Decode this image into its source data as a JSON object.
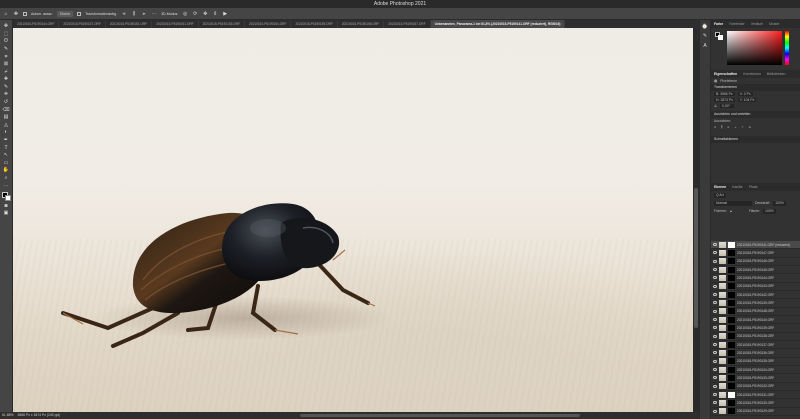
{
  "window": {
    "title": "Adobe Photoshop 2021"
  },
  "options_bar": {
    "auto_select_label": "Autom. ausw.:",
    "layer_select": "Ebene",
    "transform_label": "Transformationsstrg.",
    "three_d_label": "3D-Modus:"
  },
  "doc_tabs": [
    {
      "label": "20210015-P5190144.ORF",
      "active": false
    },
    {
      "label": "20210015-P5190157.ORF",
      "active": false
    },
    {
      "label": "20210015-P5190151.ORF",
      "active": false
    },
    {
      "label": "20210015-P5190151.ORF",
      "active": false
    },
    {
      "label": "20210015-P5190153.ORF",
      "active": false
    },
    {
      "label": "20210015-P5190154.ORF",
      "active": false
    },
    {
      "label": "20210015-P5190155.ORF",
      "active": false
    },
    {
      "label": "20210015-P5190156.ORF",
      "active": false
    },
    {
      "label": "20210015-P5190157.ORF",
      "active": false
    },
    {
      "label": "Unbenanntes_Panorama-1 bei 61,8% (20210015-P5190141.ORF (reduziert), RGB/16)",
      "active": true
    }
  ],
  "tools": [
    "move-icon",
    "marquee-icon",
    "lasso-icon",
    "quick-select-icon",
    "crop-icon",
    "frame-icon",
    "eyedropper-icon",
    "healing-icon",
    "brush-icon",
    "stamp-icon",
    "history-brush-icon",
    "eraser-icon",
    "gradient-icon",
    "blur-icon",
    "dodge-icon",
    "pen-icon",
    "type-icon",
    "path-select-icon",
    "shape-icon",
    "hand-icon",
    "zoom-icon",
    "more-icon"
  ],
  "tool_glyphs": [
    "✥",
    "⬚",
    "ʘ",
    "✎",
    "⌗",
    "⊠",
    "⌿",
    "✚",
    "✎",
    "⎈",
    "↺",
    "⌫",
    "▤",
    "◬",
    "◐",
    "✒",
    "T",
    "↖",
    "▭",
    "✋",
    "⌕",
    "⋯"
  ],
  "colors_panel": {
    "tabs": [
      "Farbe",
      "Farbfelder",
      "Verläufe",
      "Muster"
    ],
    "foreground": "#000000",
    "background": "#ffffff",
    "hue_color": "#ff1e1e"
  },
  "properties_panel": {
    "tabs": [
      "Eigenschaften",
      "Korrekturen",
      "Bibliotheken"
    ],
    "kind": "Pixelebene",
    "transform_title": "Transformieren",
    "b": "B: 3566 Px",
    "x": "X: 0 Px",
    "h": "H: 1874 Px",
    "y": "Y: 104 Px",
    "angle": "0,00°",
    "align_title": "Ausrichten und verteilen",
    "align_sub": "Ausrichten:",
    "quick_title": "Schnellaktionen"
  },
  "layers_panel": {
    "tabs": [
      "Ebenen",
      "Kanäle",
      "Pfade"
    ],
    "filter": "Q Art",
    "blend": "Normal",
    "opacity_label": "Deckkraft:",
    "opacity": "100%",
    "lock_label": "Fixieren:",
    "fill_label": "Fläche:",
    "fill": "100%",
    "layers": [
      {
        "name": "20210015-P5190141.ORF (reduziert)",
        "selected": true,
        "mask": "white"
      },
      {
        "name": "20210015-P5190147.ORF",
        "selected": false,
        "mask": "black"
      },
      {
        "name": "20210015-P5190146.ORF",
        "selected": false,
        "mask": "black"
      },
      {
        "name": "20210015-P5190145.ORF",
        "selected": false,
        "mask": "black"
      },
      {
        "name": "20210015-P5190144.ORF",
        "selected": false,
        "mask": "black"
      },
      {
        "name": "20210015-P5190143.ORF",
        "selected": false,
        "mask": "black"
      },
      {
        "name": "20210015-P5190142.ORF",
        "selected": false,
        "mask": "black"
      },
      {
        "name": "20210015-P5190149.ORF",
        "selected": false,
        "mask": "black"
      },
      {
        "name": "20210015-P5190148.ORF",
        "selected": false,
        "mask": "black"
      },
      {
        "name": "20210015-P5190140.ORF",
        "selected": false,
        "mask": "black"
      },
      {
        "name": "20210015-P5190139.ORF",
        "selected": false,
        "mask": "black"
      },
      {
        "name": "20210015-P5190138.ORF",
        "selected": false,
        "mask": "black"
      },
      {
        "name": "20210015-P5190137.ORF",
        "selected": false,
        "mask": "black"
      },
      {
        "name": "20210015-P5190136.ORF",
        "selected": false,
        "mask": "black"
      },
      {
        "name": "20210015-P5190135.ORF",
        "selected": false,
        "mask": "black"
      },
      {
        "name": "20210015-P5190134.ORF",
        "selected": false,
        "mask": "black"
      },
      {
        "name": "20210015-P5190133.ORF",
        "selected": false,
        "mask": "black"
      },
      {
        "name": "20210015-P5190132.ORF",
        "selected": false,
        "mask": "black"
      },
      {
        "name": "20210015-P5190131.ORF",
        "selected": false,
        "mask": "white"
      },
      {
        "name": "20210015-P5190130.ORF",
        "selected": false,
        "mask": "black"
      },
      {
        "name": "20210015-P5190129.ORF",
        "selected": false,
        "mask": "black"
      }
    ]
  },
  "status": {
    "zoom": "61,88%",
    "doc_size": "3566 Px x 1874 Px (240 ppi)"
  }
}
